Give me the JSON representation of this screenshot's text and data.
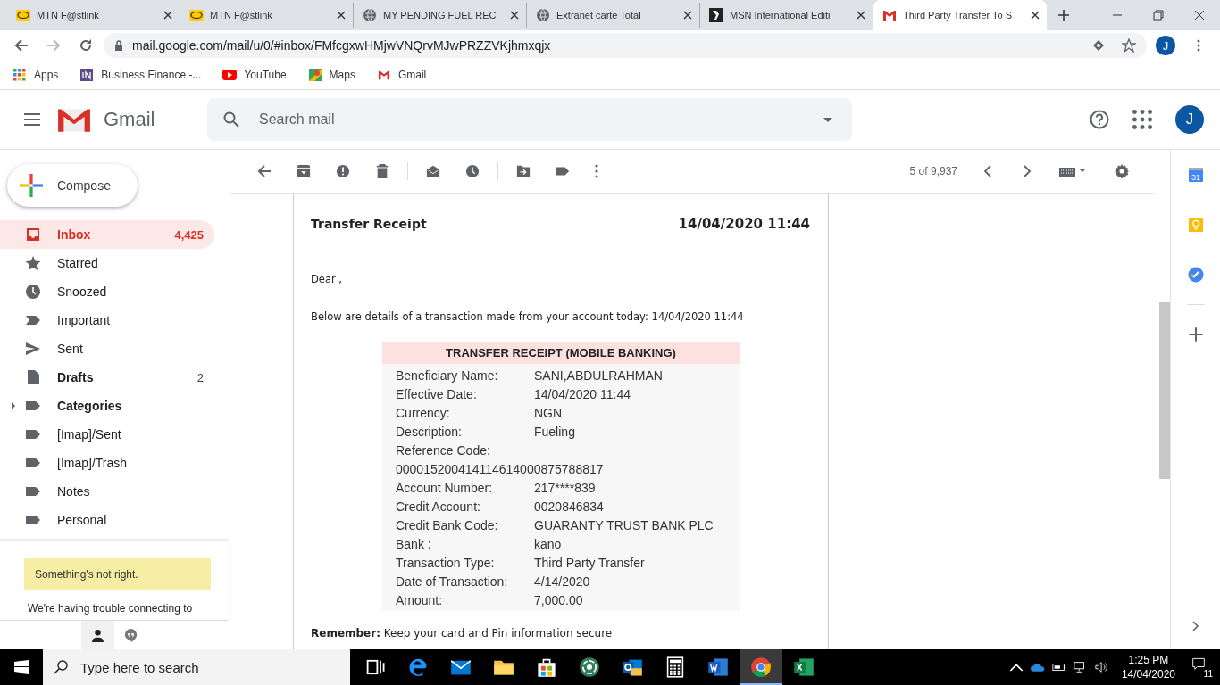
{
  "browser": {
    "tabs": [
      {
        "title": "MTN F@stlink",
        "kind": "mtn",
        "selected": false
      },
      {
        "title": "MTN F@stlink",
        "kind": "mtn",
        "selected": false
      },
      {
        "title": "MY PENDING FUEL REC",
        "kind": "globe",
        "selected": false
      },
      {
        "title": "Extranet carte Total",
        "kind": "globe",
        "selected": false
      },
      {
        "title": "MSN International Editi",
        "kind": "msn",
        "selected": false
      },
      {
        "title": "Third Party Transfer To S",
        "kind": "gmail",
        "selected": true
      }
    ],
    "address": "mail.google.com/mail/u/0/#inbox/FMfcgxwHMjwVNQrvMJwPRZZVKjhmxqjx",
    "profile_initial": "J",
    "bookmarks": [
      {
        "label": "Apps",
        "kind": "apps"
      },
      {
        "label": "Business Finance -...",
        "kind": "in"
      },
      {
        "label": "YouTube",
        "kind": "youtube"
      },
      {
        "label": "Maps",
        "kind": "maps"
      },
      {
        "label": "Gmail",
        "kind": "gmail"
      }
    ]
  },
  "gmail": {
    "brand": "Gmail",
    "search_placeholder": "Search mail",
    "account_initial": "J",
    "compose": "Compose",
    "folders": [
      {
        "label": "Inbox",
        "count": "4,425",
        "kind": "inbox",
        "selected": true,
        "unread": true,
        "expandable": false
      },
      {
        "label": "Starred",
        "kind": "star",
        "selected": false,
        "unread": false,
        "expandable": false
      },
      {
        "label": "Snoozed",
        "kind": "clock",
        "selected": false,
        "unread": false,
        "expandable": false
      },
      {
        "label": "Important",
        "kind": "important",
        "selected": false,
        "unread": false,
        "expandable": false
      },
      {
        "label": "Sent",
        "kind": "sent",
        "selected": false,
        "unread": false,
        "expandable": false
      },
      {
        "label": "Drafts",
        "count": "2",
        "kind": "draft",
        "selected": false,
        "unread": true,
        "expandable": false
      },
      {
        "label": "Categories",
        "kind": "label",
        "selected": false,
        "unread": true,
        "expandable": true
      },
      {
        "label": "[Imap]/Sent",
        "kind": "label",
        "selected": false,
        "unread": false,
        "expandable": false
      },
      {
        "label": "[Imap]/Trash",
        "kind": "label",
        "selected": false,
        "unread": false,
        "expandable": false
      },
      {
        "label": "Notes",
        "kind": "label",
        "selected": false,
        "unread": false,
        "expandable": false
      },
      {
        "label": "Personal",
        "kind": "label",
        "selected": false,
        "unread": false,
        "expandable": false
      }
    ],
    "notice": {
      "title": "Something's not right.",
      "message": "We're having trouble connecting to"
    },
    "counter": "5 of 9,937",
    "calendar_day": "31",
    "email": {
      "heading": "Transfer Receipt",
      "datetime": "14/04/2020 11:44",
      "greeting": "Dear ,",
      "intro": "Below are details of a transaction made from your account today: 14/04/2020 11:44",
      "receipt": {
        "title": "TRANSFER RECEIPT (MOBILE BANKING)",
        "rows": [
          {
            "label": "Beneficiary Name:",
            "value": "SANI,ABDULRAHMAN"
          },
          {
            "label": "Effective Date:",
            "value": "14/04/2020 11:44"
          },
          {
            "label": "Currency:",
            "value": "NGN"
          },
          {
            "label": "Description:",
            "value": "Fueling"
          },
          {
            "label": "Reference Code:"
          },
          {
            "label": "000015200414114614000875788817"
          },
          {
            "label": "Account Number:",
            "value": "217****839"
          },
          {
            "label": "Credit Account:",
            "value": "0020846834"
          },
          {
            "label": "Credit Bank Code:",
            "value": "GUARANTY TRUST BANK PLC"
          },
          {
            "label": "Bank :",
            "value": "kano"
          },
          {
            "label": "Transaction Type:",
            "value": "Third Party Transfer"
          },
          {
            "label": "Date of Transaction:",
            "value": "4/14/2020"
          },
          {
            "label": "Amount:",
            "value": "7,000.00"
          }
        ]
      },
      "footer": "**Remember:** Keep your card and Pin information secure"
    }
  },
  "taskbar": {
    "search_placeholder": "Type here to search",
    "apps": [
      {
        "kind": "taskview",
        "selected": false
      },
      {
        "kind": "edge",
        "selected": false
      },
      {
        "kind": "mail",
        "selected": false
      },
      {
        "kind": "explorer",
        "selected": false
      },
      {
        "kind": "store",
        "selected": false
      },
      {
        "kind": "ring",
        "selected": false
      },
      {
        "kind": "outlook",
        "selected": false
      },
      {
        "kind": "calculator",
        "selected": false
      },
      {
        "kind": "word",
        "selected": false
      },
      {
        "kind": "chrome",
        "selected": true
      },
      {
        "kind": "excel",
        "selected": false
      }
    ],
    "time": "1:25 PM",
    "date": "14/04/2020",
    "notifications": "11"
  }
}
